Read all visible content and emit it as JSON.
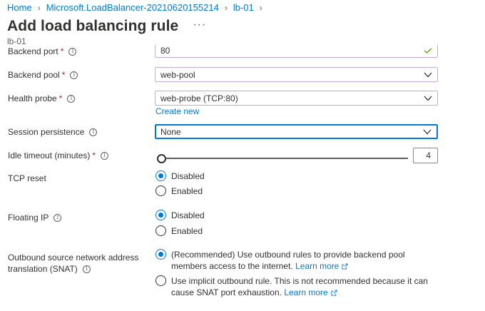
{
  "breadcrumb": {
    "home": "Home",
    "resource": "Microsoft.LoadBalancer-20210620155214",
    "current": "lb-01"
  },
  "page": {
    "title": "Add load balancing rule",
    "more": "···",
    "subtitle": "lb-01"
  },
  "form": {
    "backend_port": {
      "label": "Backend port",
      "required": "*",
      "value": "80"
    },
    "backend_pool": {
      "label": "Backend pool",
      "required": "*",
      "value": "web-pool"
    },
    "health_probe": {
      "label": "Health probe",
      "required": "*",
      "value": "web-probe (TCP:80)",
      "create_new": "Create new"
    },
    "session_persistence": {
      "label": "Session persistence",
      "value": "None"
    },
    "idle_timeout": {
      "label": "Idle timeout (minutes)",
      "required": "*",
      "value": "4",
      "slider_level": 0
    },
    "tcp_reset": {
      "label": "TCP reset",
      "options": [
        "Disabled",
        "Enabled"
      ],
      "selected": "Disabled"
    },
    "floating_ip": {
      "label": "Floating IP",
      "options": [
        "Disabled",
        "Enabled"
      ],
      "selected": "Disabled"
    },
    "snat": {
      "label_line1": "Outbound source network address",
      "label_line2": "translation (SNAT)",
      "option1": "(Recommended) Use outbound rules to provide backend pool members access to the internet.",
      "option2": "Use implicit outbound rule. This is not recommended because it can cause SNAT port exhaustion.",
      "learn_more": "Learn more",
      "selected": "option1"
    }
  },
  "colors": {
    "accent": "#0078d4",
    "required": "#a4262c",
    "text": "#323130",
    "border": "#8a8886"
  },
  "icons": {
    "info": "info-icon",
    "chevron": "chevron-down-icon",
    "external": "external-link-icon"
  }
}
